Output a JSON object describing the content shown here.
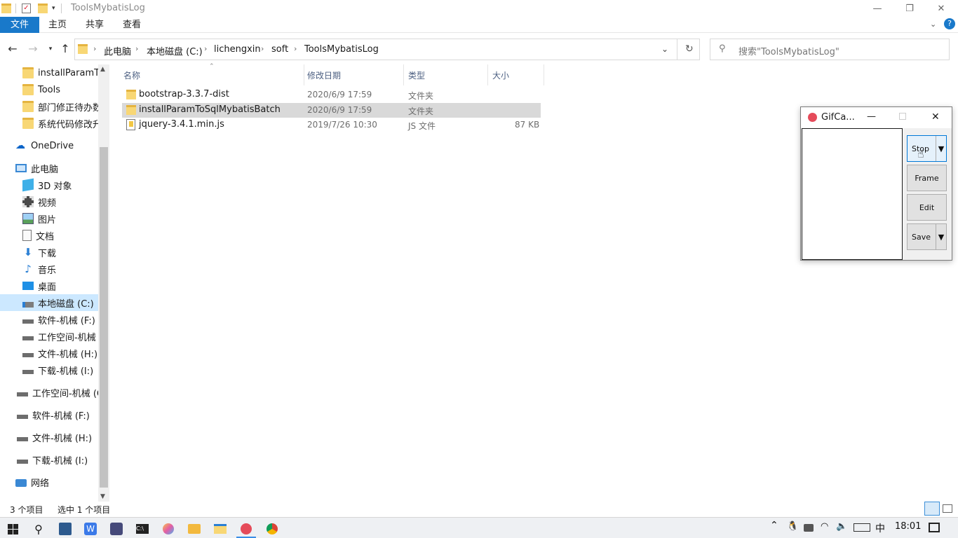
{
  "window": {
    "title": "ToolsMybatisLog",
    "minimize": "—",
    "maximize": "❐",
    "close": "✕"
  },
  "ribbon": {
    "tabs": [
      "文件",
      "主页",
      "共享",
      "查看"
    ],
    "collapse_icon": "chevron-down-icon",
    "help": "?"
  },
  "address": {
    "crumbs": [
      "此电脑",
      "本地磁盘 (C:)",
      "lichengxin",
      "soft",
      "ToolsMybatisLog"
    ],
    "search_placeholder": "搜索\"ToolsMybatisLog\""
  },
  "sidebar": {
    "items": [
      {
        "label": "installParamTo",
        "icon": "folder-icon",
        "indent": 1
      },
      {
        "label": "Tools",
        "icon": "folder-icon",
        "indent": 1
      },
      {
        "label": "部门修正待办数据",
        "icon": "folder-icon",
        "indent": 1
      },
      {
        "label": "系统代码修改升级",
        "icon": "folder-icon",
        "indent": 1
      },
      {
        "label": "OneDrive",
        "icon": "cloud-icon",
        "indent": 0
      },
      {
        "label": "此电脑",
        "icon": "computer-icon",
        "indent": 0
      },
      {
        "label": "3D 对象",
        "icon": "cube-icon",
        "indent": 1
      },
      {
        "label": "视频",
        "icon": "film-icon",
        "indent": 1
      },
      {
        "label": "图片",
        "icon": "picture-icon",
        "indent": 1
      },
      {
        "label": "文档",
        "icon": "document-icon",
        "indent": 1
      },
      {
        "label": "下载",
        "icon": "download-icon",
        "indent": 1
      },
      {
        "label": "音乐",
        "icon": "music-icon",
        "indent": 1
      },
      {
        "label": "桌面",
        "icon": "desktop-icon",
        "indent": 1
      },
      {
        "label": "本地磁盘 (C:)",
        "icon": "system-drive-icon",
        "indent": 1
      },
      {
        "label": "软件-机械 (F:)",
        "icon": "drive-icon",
        "indent": 1
      },
      {
        "label": "工作空间-机械 (",
        "icon": "drive-icon",
        "indent": 1
      },
      {
        "label": "文件-机械 (H:)",
        "icon": "drive-icon",
        "indent": 1
      },
      {
        "label": "下载-机械 (I:)",
        "icon": "drive-icon",
        "indent": 1
      },
      {
        "label": "工作空间-机械 (G",
        "icon": "drive-icon",
        "indent": 0
      },
      {
        "label": "软件-机械 (F:)",
        "icon": "drive-icon",
        "indent": 0
      },
      {
        "label": "文件-机械 (H:)",
        "icon": "drive-icon",
        "indent": 0
      },
      {
        "label": "下载-机械 (I:)",
        "icon": "drive-icon",
        "indent": 0
      },
      {
        "label": "网络",
        "icon": "network-icon",
        "indent": 0
      }
    ]
  },
  "filelist": {
    "columns": [
      "名称",
      "修改日期",
      "类型",
      "大小"
    ],
    "rows": [
      {
        "name": "bootstrap-3.3.7-dist",
        "date": "2020/6/9 17:59",
        "type": "文件夹",
        "size": "",
        "icon": "folder-icon"
      },
      {
        "name": "installParamToSqlMybatisBatch",
        "date": "2020/6/9 17:59",
        "type": "文件夹",
        "size": "",
        "icon": "folder-icon"
      },
      {
        "name": "jquery-3.4.1.min.js",
        "date": "2019/7/26 10:30",
        "type": "JS 文件",
        "size": "87 KB",
        "icon": "js-file-icon"
      }
    ]
  },
  "status": {
    "count": "3 个项目",
    "selected": "选中 1 个项目"
  },
  "gifcam": {
    "title": "GifCa...",
    "buttons": [
      "Stop",
      "Frame",
      "Edit",
      "Save"
    ]
  },
  "taskbar": {
    "ime": "中",
    "time": "18:01"
  },
  "colors": {
    "accent": "#1979ca",
    "selection": "#cce8ff",
    "row_selected": "#d9d9d9",
    "folder": "#f8d775"
  }
}
